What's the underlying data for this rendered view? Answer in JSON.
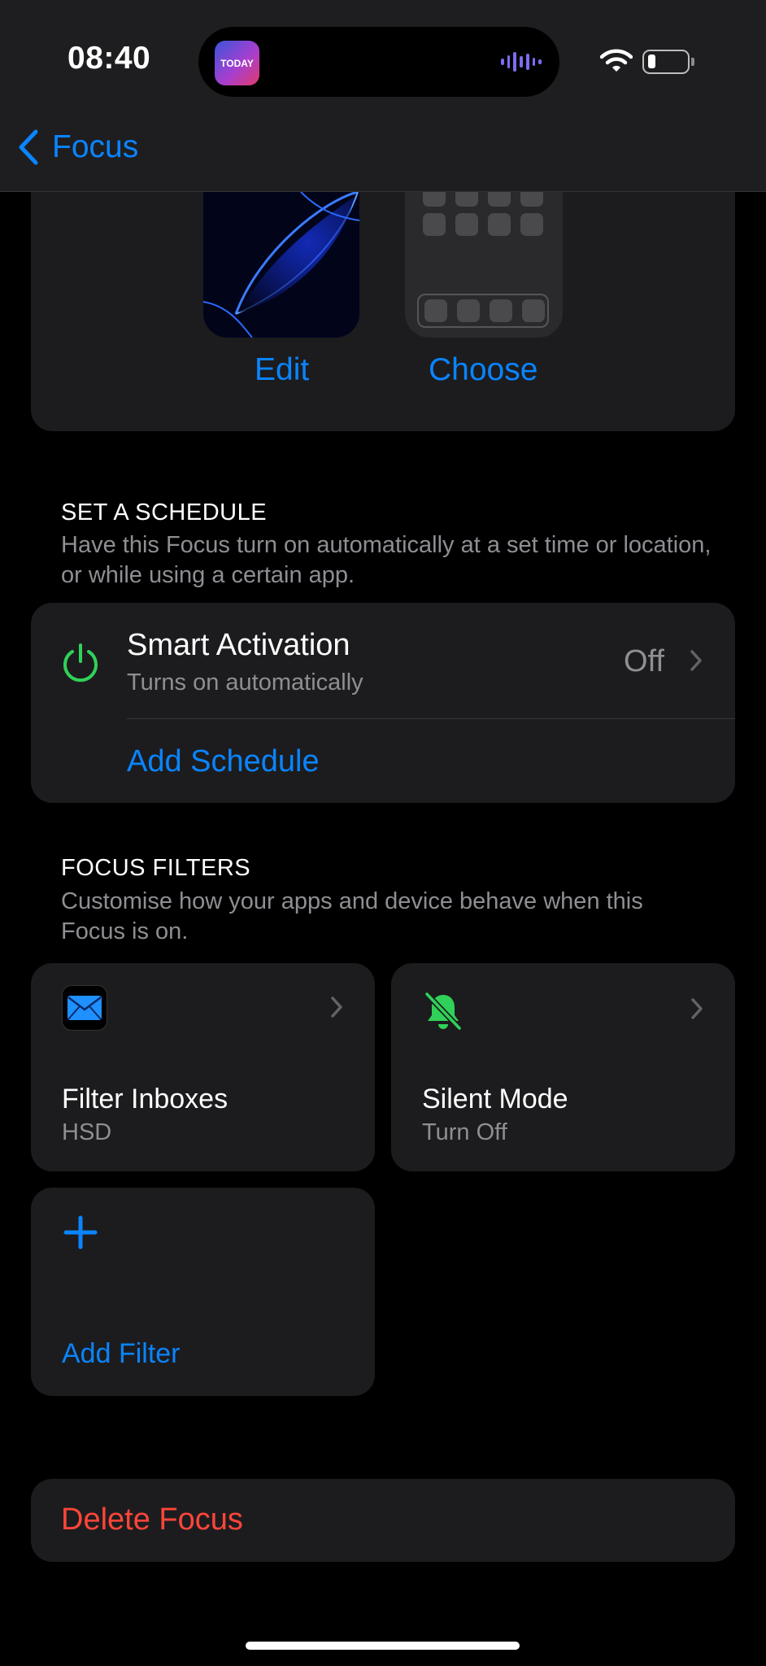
{
  "status_bar": {
    "time": "08:40",
    "live_activity_app": "TODAY",
    "icons": [
      "wifi-icon",
      "battery-icon"
    ]
  },
  "nav": {
    "back_label": "Focus"
  },
  "wallpaper": {
    "edit_label": "Edit",
    "choose_label": "Choose"
  },
  "schedule": {
    "header": "SET A SCHEDULE",
    "description": "Have this Focus turn on automatically at a set time or location, or while using a certain app.",
    "smart_activation": {
      "title": "Smart Activation",
      "subtitle": "Turns on automatically",
      "value": "Off"
    },
    "add_schedule_label": "Add Schedule"
  },
  "filters": {
    "header": "FOCUS FILTERS",
    "description": "Customise how your apps and device behave when this Focus is on.",
    "items": [
      {
        "title": "Filter Inboxes",
        "subtitle": "HSD",
        "icon": "mail-icon"
      },
      {
        "title": "Silent Mode",
        "subtitle": "Turn Off",
        "icon": "bell-slash-icon"
      }
    ],
    "add_filter_label": "Add Filter"
  },
  "delete_label": "Delete Focus",
  "colors": {
    "accent": "#0a84ff",
    "destructive": "#ff453a",
    "green": "#30d158",
    "card": "#1c1c1e"
  }
}
